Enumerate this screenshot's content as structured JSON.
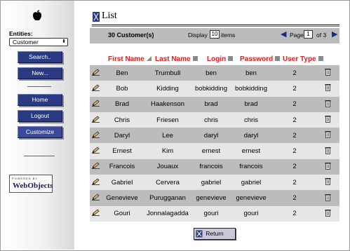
{
  "sidebar": {
    "logo": "apple-logo",
    "entities_label": "Entities:",
    "entity_selected": "Customer",
    "buttons": {
      "search": "Search..",
      "new": "New...",
      "home": "Home",
      "logout": "Logout",
      "customize": "Customize"
    },
    "badge_small": "POWERED BY",
    "badge_big": "WebObjects"
  },
  "main": {
    "title": "List",
    "count_label": "30 Customer(s)",
    "display_label": "Display",
    "display_value": "10",
    "items_label": "items",
    "page_label": "Page",
    "page_value": "1",
    "of_label": "of 3",
    "columns": [
      "First Name",
      "Last Name",
      "Login",
      "Password",
      "User Type"
    ],
    "rows": [
      [
        "Ben",
        "Trumbull",
        "ben",
        "ben",
        "2"
      ],
      [
        "Bob",
        "Kidding",
        "bobkidding",
        "bobkidding",
        "2"
      ],
      [
        "Brad",
        "Haakenson",
        "brad",
        "brad",
        "2"
      ],
      [
        "Chris",
        "Friesen",
        "chris",
        "chris",
        "2"
      ],
      [
        "Daryl",
        "Lee",
        "daryl",
        "daryl",
        "2"
      ],
      [
        "Ernest",
        "Kim",
        "ernest",
        "ernest",
        "2"
      ],
      [
        "Francois",
        "Jouaux",
        "francois",
        "francois",
        "2"
      ],
      [
        "Gabriel",
        "Cervera",
        "gabriel",
        "gabriel",
        "2"
      ],
      [
        "Genevieve",
        "Purugganan",
        "genevieve",
        "genevieve",
        "2"
      ],
      [
        "Gouri",
        "Jonnalagadda",
        "gouri",
        "gouri",
        "2"
      ]
    ],
    "return_label": "Return"
  },
  "colors": {
    "header_red": "#d42222",
    "nav_blue": "#2a3a82",
    "row_dark": "#bcbcbc",
    "row_light": "#e6e6e6"
  }
}
